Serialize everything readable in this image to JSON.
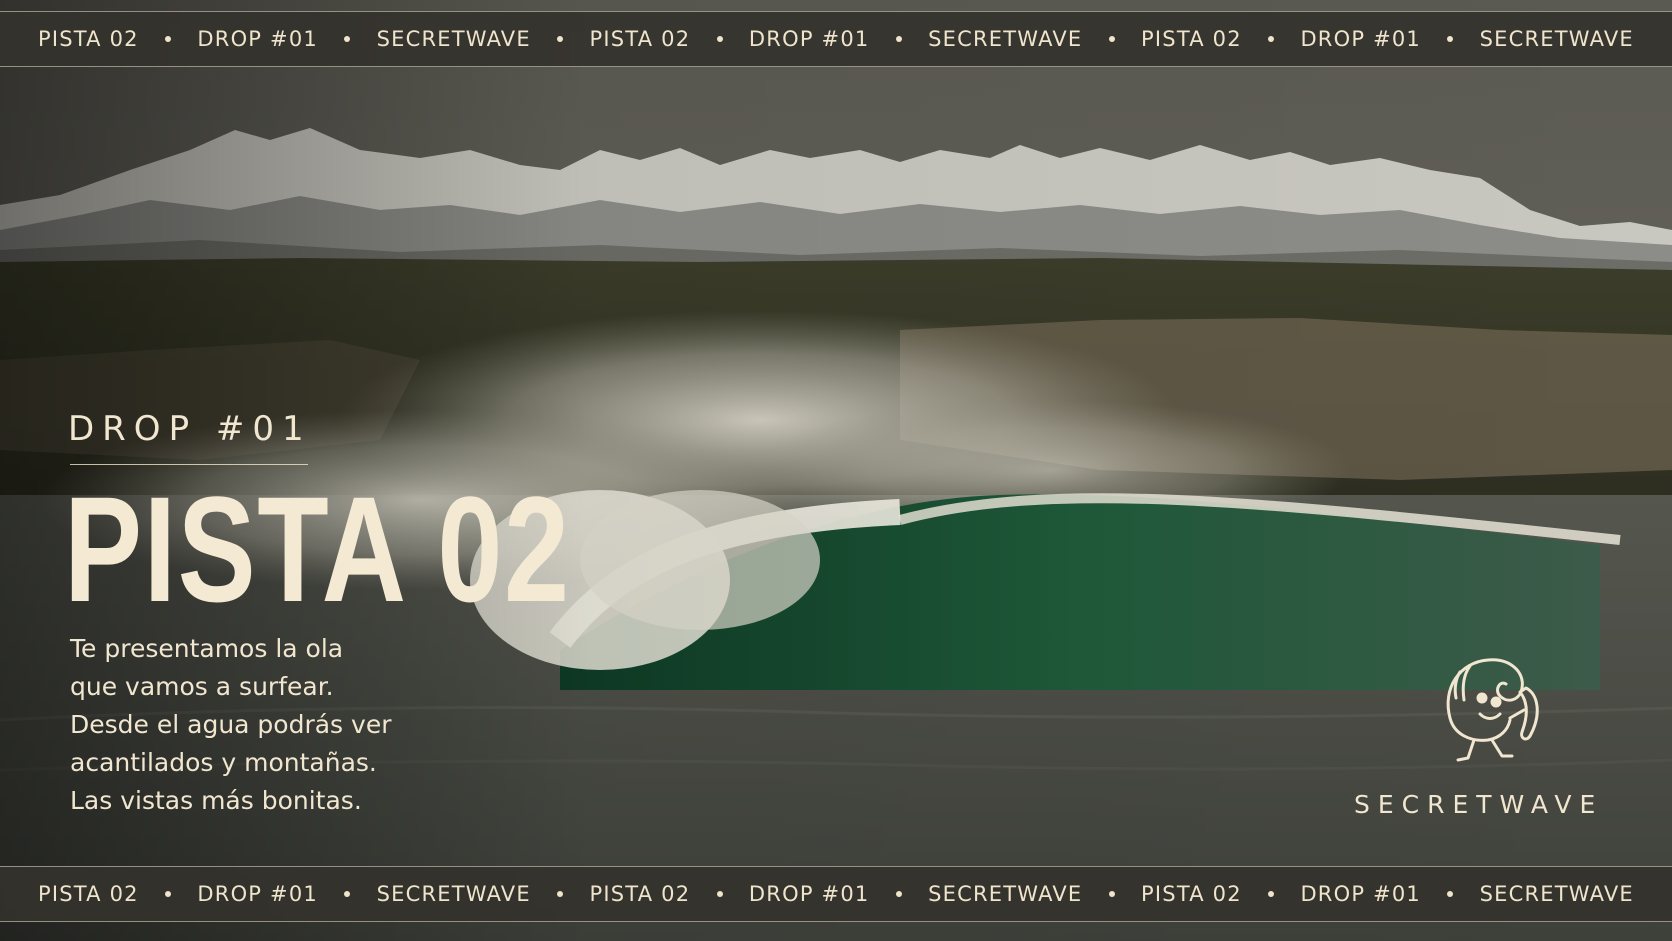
{
  "ticker_top": [
    "PISTA 02",
    "DROP #01",
    "SECRETWAVE",
    "PISTA 02",
    "DROP #01",
    "SECRETWAVE",
    "PISTA 02",
    "DROP #01",
    "SECRETWAVE"
  ],
  "ticker_bottom": [
    "PISTA 02",
    "DROP #01",
    "SECRETWAVE",
    "PISTA 02",
    "DROP #01",
    "SECRETWAVE",
    "PISTA 02",
    "DROP #01",
    "SECRETWAVE"
  ],
  "hero": {
    "eyebrow": "DROP #01",
    "title": "PISTA 02",
    "body_lines": [
      "Te presentamos la ola",
      "que vamos a surfear.",
      "Desde el agua podrás ver",
      "acantilados y montañas.",
      "Las vistas más bonitas."
    ]
  },
  "brand": {
    "name": "SECRETWAVE",
    "logo_icon": "surfing-wave-mascot-icon"
  },
  "colors": {
    "cream": "#f1e6cf",
    "band": "#34322c",
    "wave_green": "#1f5a3a"
  }
}
